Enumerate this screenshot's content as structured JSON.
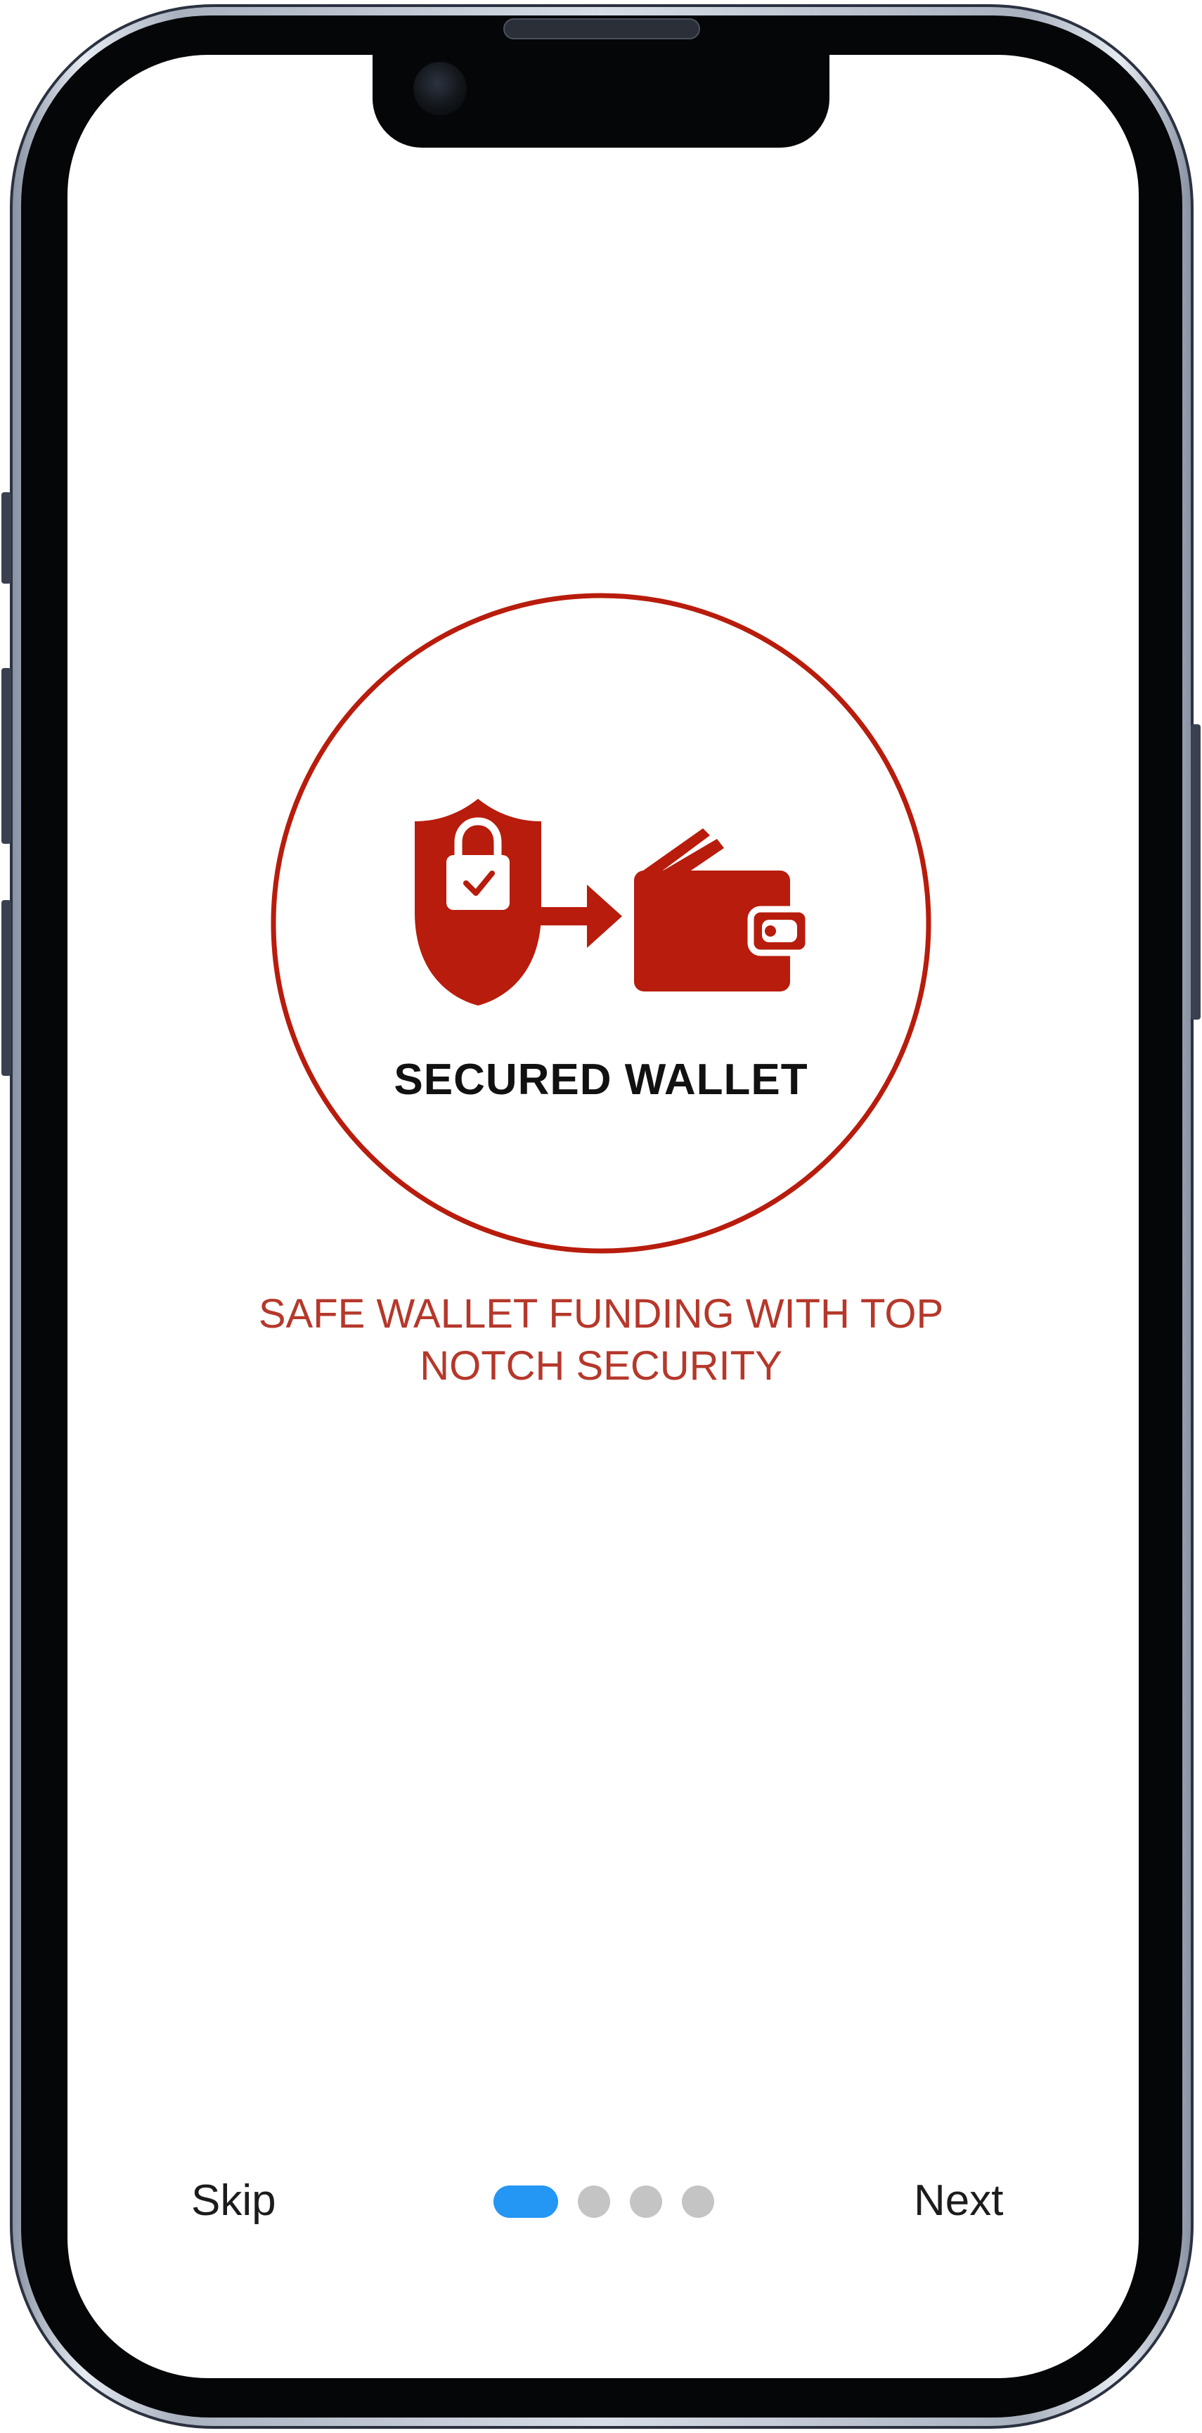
{
  "onboarding": {
    "illustration_title": "SECURED WALLET",
    "subtitle": "SAFE WALLET FUNDING WITH TOP NOTCH SECURITY",
    "skip_label": "Skip",
    "next_label": "Next",
    "page_count": 4,
    "current_page": 1
  },
  "colors": {
    "brand_red": "#b81c0c",
    "subtitle_red": "#b5382b",
    "active_dot": "#2496f3",
    "inactive_dot": "#c4c4c4"
  },
  "icons": [
    "shield-lock-icon",
    "arrow-right-icon",
    "wallet-icon"
  ]
}
